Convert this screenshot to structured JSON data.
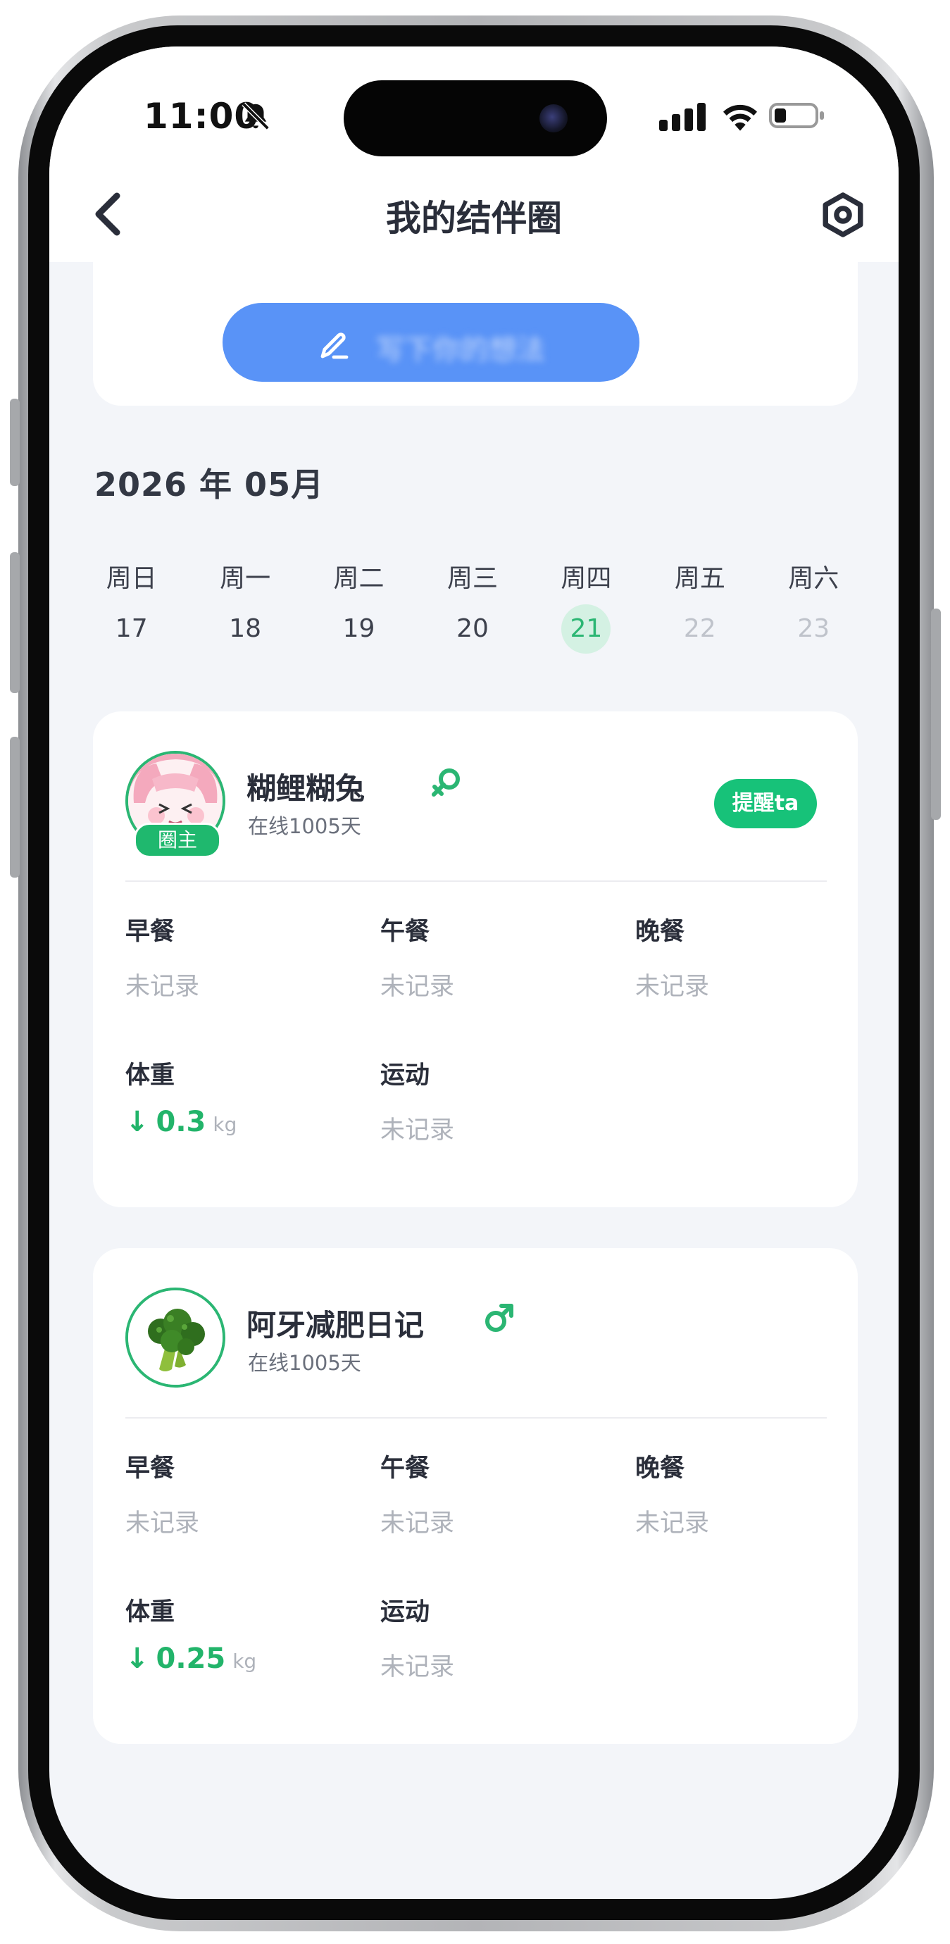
{
  "status": {
    "time": "11:00"
  },
  "nav": {
    "title": "我的结伴圈"
  },
  "top": {
    "write_label": "写下你的想法"
  },
  "calendar": {
    "month": "2026 年 05月",
    "weekdays": [
      "周日",
      "周一",
      "周二",
      "周三",
      "周四",
      "周五",
      "周六"
    ],
    "dates": [
      "17",
      "18",
      "19",
      "20",
      "21",
      "22",
      "23"
    ],
    "selected_date": "21"
  },
  "members": [
    {
      "name": "糊鲤糊兔",
      "gender": "female",
      "online": "在线1005天",
      "badge": "圈主",
      "remind": "提醒ta",
      "breakfast": {
        "label": "早餐",
        "value": "未记录"
      },
      "lunch": {
        "label": "午餐",
        "value": "未记录"
      },
      "dinner": {
        "label": "晚餐",
        "value": "未记录"
      },
      "weight": {
        "label": "体重",
        "arrow": "↓",
        "value": "0.3",
        "unit": "kg"
      },
      "exercise": {
        "label": "运动",
        "value": "未记录"
      }
    },
    {
      "name": "阿牙减肥日记",
      "gender": "male",
      "online": "在线1005天",
      "breakfast": {
        "label": "早餐",
        "value": "未记录"
      },
      "lunch": {
        "label": "午餐",
        "value": "未记录"
      },
      "dinner": {
        "label": "晚餐",
        "value": "未记录"
      },
      "weight": {
        "label": "体重",
        "arrow": "↓",
        "value": "0.25",
        "unit": "kg"
      },
      "exercise": {
        "label": "运动",
        "value": "未记录"
      }
    }
  ],
  "colors": {
    "accent": "#17c279",
    "primary_button": "#5993f7",
    "background": "#f3f5f9"
  }
}
